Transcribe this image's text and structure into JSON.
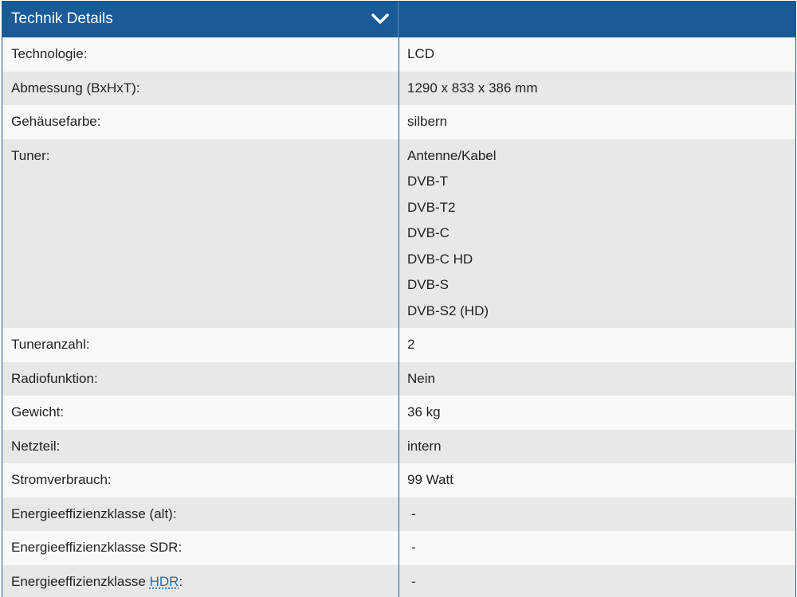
{
  "header": {
    "title": "Technik Details",
    "toggle_icon": "chevron-down-icon"
  },
  "colors": {
    "header_bg": "#1a5a96",
    "row_light": "#f9f9f9",
    "row_dark": "#e8e8e8",
    "link": "#1a6fb5"
  },
  "rows": [
    {
      "label": "Technologie:",
      "values": [
        "LCD"
      ]
    },
    {
      "label": "Abmessung (BxHxT):",
      "values": [
        "1290 x 833 x 386 mm"
      ]
    },
    {
      "label": "Gehäusefarbe:",
      "values": [
        "silbern"
      ]
    },
    {
      "label": "Tuner:",
      "values": [
        "Antenne/Kabel",
        "DVB-T",
        "DVB-T2",
        "DVB-C",
        "DVB-C HD",
        "DVB-S",
        "DVB-S2 (HD)"
      ]
    },
    {
      "label": "Tuneranzahl:",
      "values": [
        "2"
      ]
    },
    {
      "label": "Radiofunktion:",
      "values": [
        "Nein"
      ]
    },
    {
      "label": "Gewicht:",
      "values": [
        "36 kg"
      ]
    },
    {
      "label": "Netzteil:",
      "values": [
        "intern"
      ]
    },
    {
      "label": "Stromverbrauch:",
      "values": [
        "99 Watt"
      ]
    },
    {
      "label": "Energieeffizienzklasse (alt):",
      "values": [
        "-"
      ]
    },
    {
      "label": "Energieeffizienzklasse SDR:",
      "values": [
        "-"
      ]
    },
    {
      "label": "Energieeffizienzklasse HDR:",
      "label_prefix": "Energieeffizienzklasse ",
      "label_link": "HDR",
      "label_suffix": ":",
      "values": [
        "-"
      ]
    }
  ]
}
